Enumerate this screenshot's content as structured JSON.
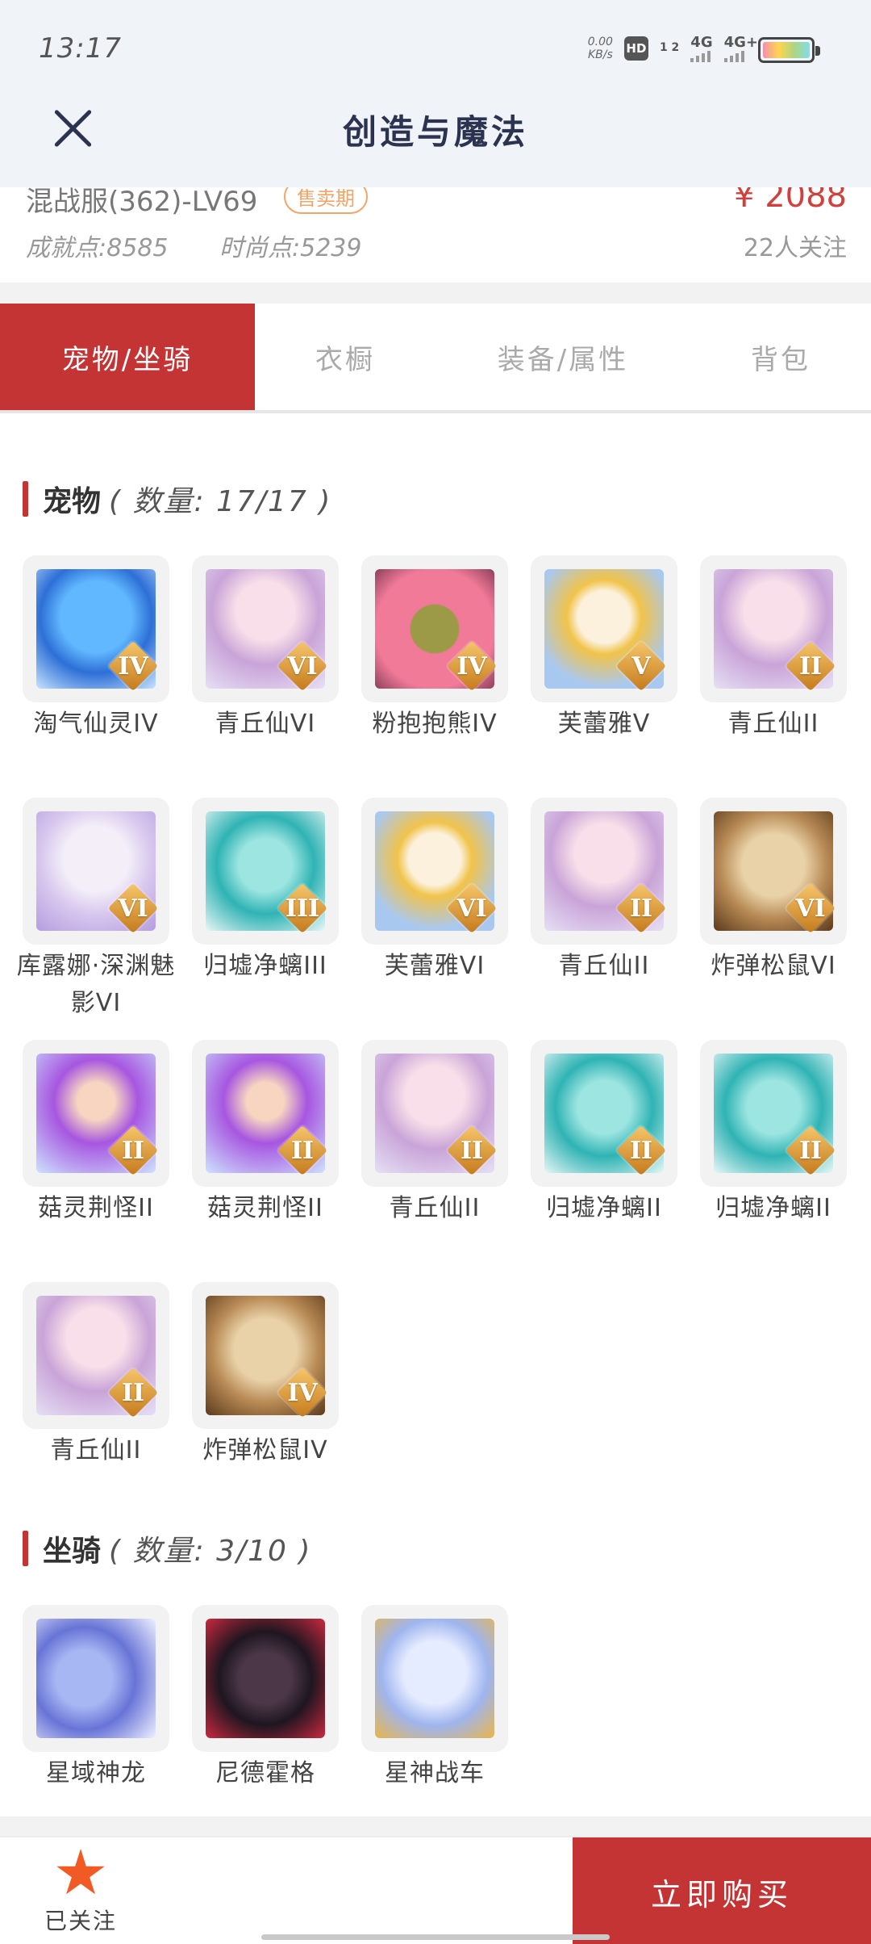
{
  "status": {
    "time": "13:17",
    "speed_value": "0.00",
    "speed_unit": "KB/s",
    "hd": "HD",
    "hd_sub": "1 2",
    "net1": "4G",
    "net2": "4G+"
  },
  "header": {
    "title": "创造与魔法"
  },
  "info": {
    "server": "混战服(362)-LV69",
    "sale_badge": "售卖期",
    "price": "¥ 2088",
    "achievement": "成就点:8585",
    "fashion": "时尚点:5239",
    "followers": "22人关注"
  },
  "tabs": [
    "宠物/坐骑",
    "衣橱",
    "装备/属性",
    "背包"
  ],
  "pets": {
    "title": "宠物",
    "count": "( 数量: 17/17 )",
    "items": [
      {
        "name": "淘气仙灵IV",
        "rank": "IV",
        "icon": "blue"
      },
      {
        "name": "青丘仙VI",
        "rank": "VI",
        "icon": "fox"
      },
      {
        "name": "粉抱抱熊IV",
        "rank": "IV",
        "icon": "bear"
      },
      {
        "name": "芙蕾雅V",
        "rank": "V",
        "icon": "gold"
      },
      {
        "name": "青丘仙II",
        "rank": "II",
        "icon": "fox"
      },
      {
        "name": "库露娜·深渊魅影VI",
        "rank": "VI",
        "icon": "white"
      },
      {
        "name": "归墟净螭III",
        "rank": "III",
        "icon": "dragon"
      },
      {
        "name": "芙蕾雅VI",
        "rank": "VI",
        "icon": "gold"
      },
      {
        "name": "青丘仙II",
        "rank": "II",
        "icon": "fox"
      },
      {
        "name": "炸弹松鼠VI",
        "rank": "VI",
        "icon": "squirrel"
      },
      {
        "name": "菇灵荆怪II",
        "rank": "II",
        "icon": "purple"
      },
      {
        "name": "菇灵荆怪II",
        "rank": "II",
        "icon": "purple"
      },
      {
        "name": "青丘仙II",
        "rank": "II",
        "icon": "fox"
      },
      {
        "name": "归墟净螭II",
        "rank": "II",
        "icon": "dragon"
      },
      {
        "name": "归墟净螭II",
        "rank": "II",
        "icon": "dragon"
      },
      {
        "name": "青丘仙II",
        "rank": "II",
        "icon": "fox"
      },
      {
        "name": "炸弹松鼠IV",
        "rank": "IV",
        "icon": "squirrel"
      }
    ]
  },
  "mounts": {
    "title": "坐骑",
    "count": "( 数量: 3/10 )",
    "items": [
      {
        "name": "星域神龙",
        "icon": "sky"
      },
      {
        "name": "尼德霍格",
        "icon": "dark"
      },
      {
        "name": "星神战车",
        "icon": "ice"
      }
    ]
  },
  "bottom": {
    "follow_label": "已关注",
    "buy_label": "立即购买",
    "accent": "#c43434"
  }
}
